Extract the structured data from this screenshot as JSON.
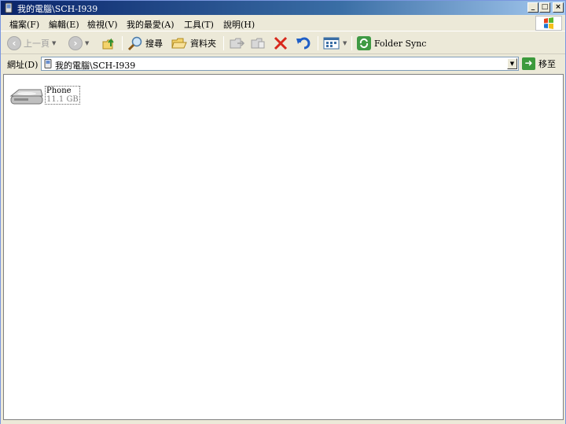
{
  "window": {
    "title": "我的電腦\\SCH-I939"
  },
  "title_buttons": {
    "minimize": "_",
    "maximize": "□",
    "close": "×"
  },
  "menu": [
    {
      "label": "檔案(F)"
    },
    {
      "label": "編輯(E)"
    },
    {
      "label": "檢視(V)"
    },
    {
      "label": "我的最愛(A)"
    },
    {
      "label": "工具(T)"
    },
    {
      "label": "說明(H)"
    }
  ],
  "toolbar": {
    "back_label": "上一頁",
    "search_label": "搜尋",
    "folders_label": "資料夾",
    "foldersync_label": "Folder Sync"
  },
  "address": {
    "label": "網址(D)",
    "value": "我的電腦\\SCH-I939",
    "go_label": "移至"
  },
  "items": [
    {
      "name": "Phone",
      "size": "11.1 GB",
      "icon": "drive-icon"
    }
  ],
  "colors": {
    "titlebar_start": "#0a246a",
    "titlebar_end": "#a6caf0",
    "chrome": "#ece9d8"
  }
}
